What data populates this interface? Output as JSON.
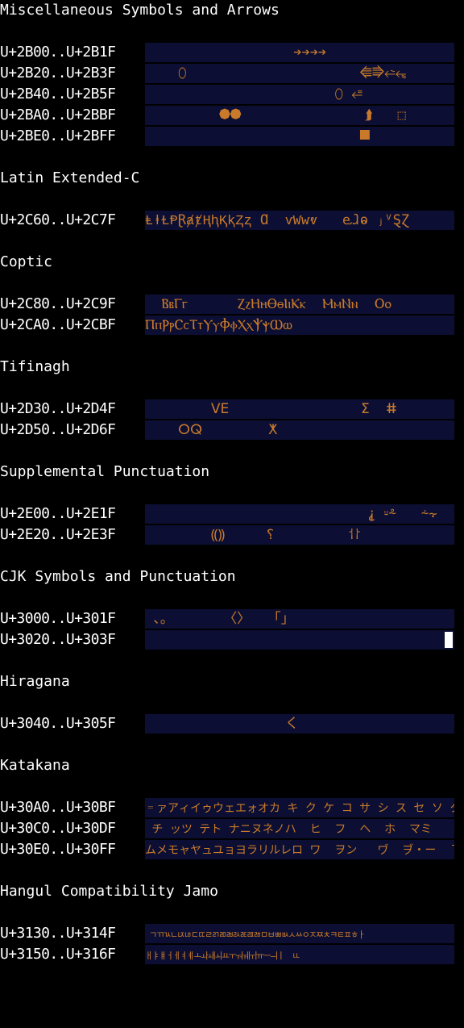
{
  "sections": [
    {
      "title": "Miscellaneous Symbols and Arrows",
      "rows": [
        {
          "range": "U+2B00..U+2B1F",
          "glyphs": "                  ➔➔➔➔         "
        },
        {
          "range": "U+2B20..U+2B3F",
          "glyphs": "    ⬯                     ⭅⭆⭉⭊"
        },
        {
          "range": "U+2B40..U+2B5F",
          "glyphs": "                       ⬯ ⭀   "
        },
        {
          "range": "U+2BA0..U+2BBF",
          "glyphs": "         ⯄⯄               ⮭   ⬚"
        },
        {
          "range": "U+2BE0..U+2BFF",
          "glyphs": "                          ⯀   "
        }
      ]
    },
    {
      "title": "Latin Extended-C",
      "rows": [
        {
          "range": "U+2C60..U+2C7F",
          "glyphs": "ⱠⱡⱢⱣⱤⱥⱦⱧⱨⱩⱪⱫⱬ Ɑ  ⱱⱲⱳⱴ   ⱸⱹⱺ ⱼⱽⱾⱿ"
        }
      ]
    },
    {
      "title": "Coptic",
      "rows": [
        {
          "range": "U+2C80..U+2C9F",
          "glyphs": "  ⲂⲃⲄⲅ      ⲌⲍⲎⲏⲐⲑⲒⲓⲔⲕ  ⲘⲙⲚⲛ  Ⲟⲟ"
        },
        {
          "range": "U+2CA0..U+2CBF",
          "glyphs": "ⲠⲡⲢⲣⲤⲥⲦⲧⲨⲩⲪⲫⲬⲭⲮⲯⲰⲱ"
        }
      ]
    },
    {
      "title": "Tifinagh",
      "rows": [
        {
          "range": "U+2D30..U+2D4F",
          "glyphs": "        ⴸⴹ                ⵉ  ⵌ"
        },
        {
          "range": "U+2D50..U+2D6F",
          "glyphs": "    ⵔⵕ        ⵅ"
        }
      ]
    },
    {
      "title": "Supplemental Punctuation",
      "rows": [
        {
          "range": "U+2E00..U+2E1F",
          "glyphs": "                           ⸘ ⸚⸛   ⸞⸟"
        },
        {
          "range": "U+2E20..U+2E3F",
          "glyphs": "        ⸨⸩     ⸮         ⸶⸷"
        }
      ]
    },
    {
      "title": "CJK Symbols and Punctuation",
      "rows": [
        {
          "range": "U+3000..U+301F",
          "glyphs": " 、。      〈〉  「」"
        },
        {
          "range": "U+3020..U+303F",
          "glyphs": ""
        }
      ]
    },
    {
      "title": "Hiragana",
      "rows": [
        {
          "range": "U+3040..U+305F",
          "glyphs": "                 く"
        }
      ]
    },
    {
      "title": "Katakana",
      "rows": [
        {
          "range": "U+30A0..U+30BF",
          "glyphs": "゠ァアィイゥウェエォオカ キ ク ケ コ サ シ ス セ ソ タ"
        },
        {
          "range": "U+30C0..U+30DF",
          "glyphs": " チ ッツ テト ナニヌネノハ  ヒ  フ  ヘ  ホ  マミ"
        },
        {
          "range": "U+30E0..U+30FF",
          "glyphs": "ムメモャヤュユョヨラリルレロ ワ  ヲン   ヷ  ヺ・ー  ヿ"
        }
      ]
    },
    {
      "title": "Hangul Compatibility Jamo",
      "rows": [
        {
          "range": "U+3130..U+314F",
          "glyphs": " ㄱㄲㄳㄴㄵㄶㄷㄸㄹㄺㄻㄼㄽㄾㄿㅀㅁㅂㅃㅄㅅㅆㅇㅈㅉㅊㅋㅌㅍㅎㅏ"
        },
        {
          "range": "U+3150..U+316F",
          "glyphs": "ㅐㅑㅒㅓㅔㅕㅖㅗㅘㅙㅚㅛㅜㅝㅞㅟㅠㅡㅢㅣㅤㅥ"
        }
      ]
    }
  ]
}
